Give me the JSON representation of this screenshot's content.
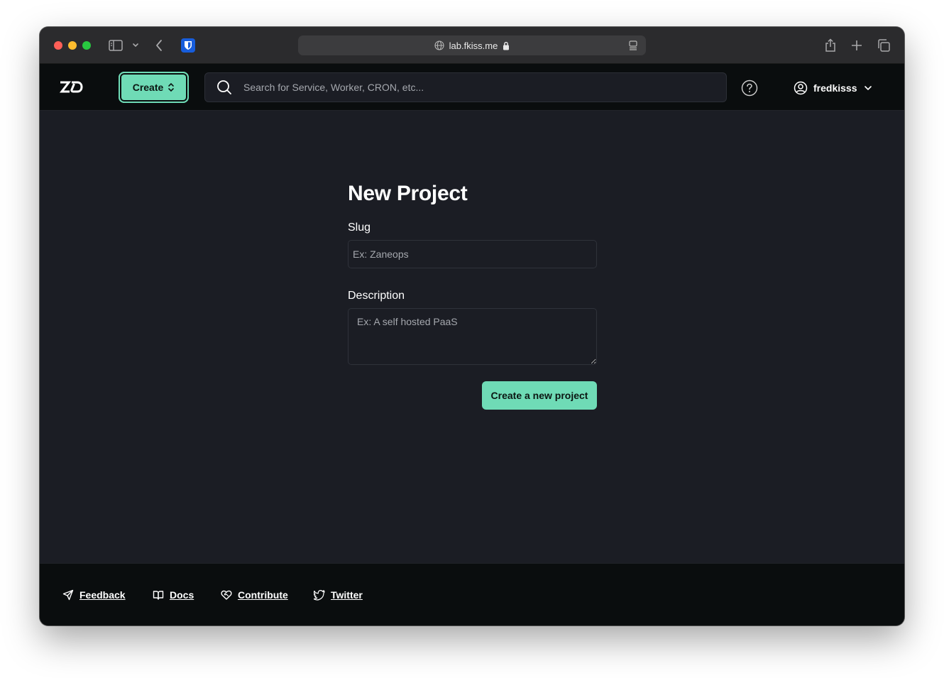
{
  "browser": {
    "url": "lab.fkiss.me",
    "icons": [
      "sidebar-icon",
      "chevron-down-icon",
      "back-icon",
      "bitwarden-icon",
      "globe-icon",
      "lock-icon",
      "reader-icon",
      "share-icon",
      "plus-icon",
      "tabs-icon"
    ]
  },
  "header": {
    "logo_icon": "zaneops-logo-icon",
    "create_label": "Create",
    "search_placeholder": "Search for Service, Worker, CRON, etc...",
    "username": "fredkisss"
  },
  "form": {
    "title": "New Project",
    "slug_label": "Slug",
    "slug_placeholder": "Ex: Zaneops",
    "slug_value": "",
    "description_label": "Description",
    "description_placeholder": "Ex: A self hosted PaaS",
    "description_value": "",
    "submit_label": "Create a new project"
  },
  "footer": {
    "links": [
      {
        "label": "Feedback",
        "icon": "send-icon"
      },
      {
        "label": "Docs",
        "icon": "book-icon"
      },
      {
        "label": "Contribute",
        "icon": "heart-handshake-icon"
      },
      {
        "label": "Twitter",
        "icon": "twitter-icon"
      }
    ]
  },
  "colors": {
    "accent": "#6fdbb6",
    "background": "#1b1d24",
    "header_bg": "#0a0d0e"
  }
}
